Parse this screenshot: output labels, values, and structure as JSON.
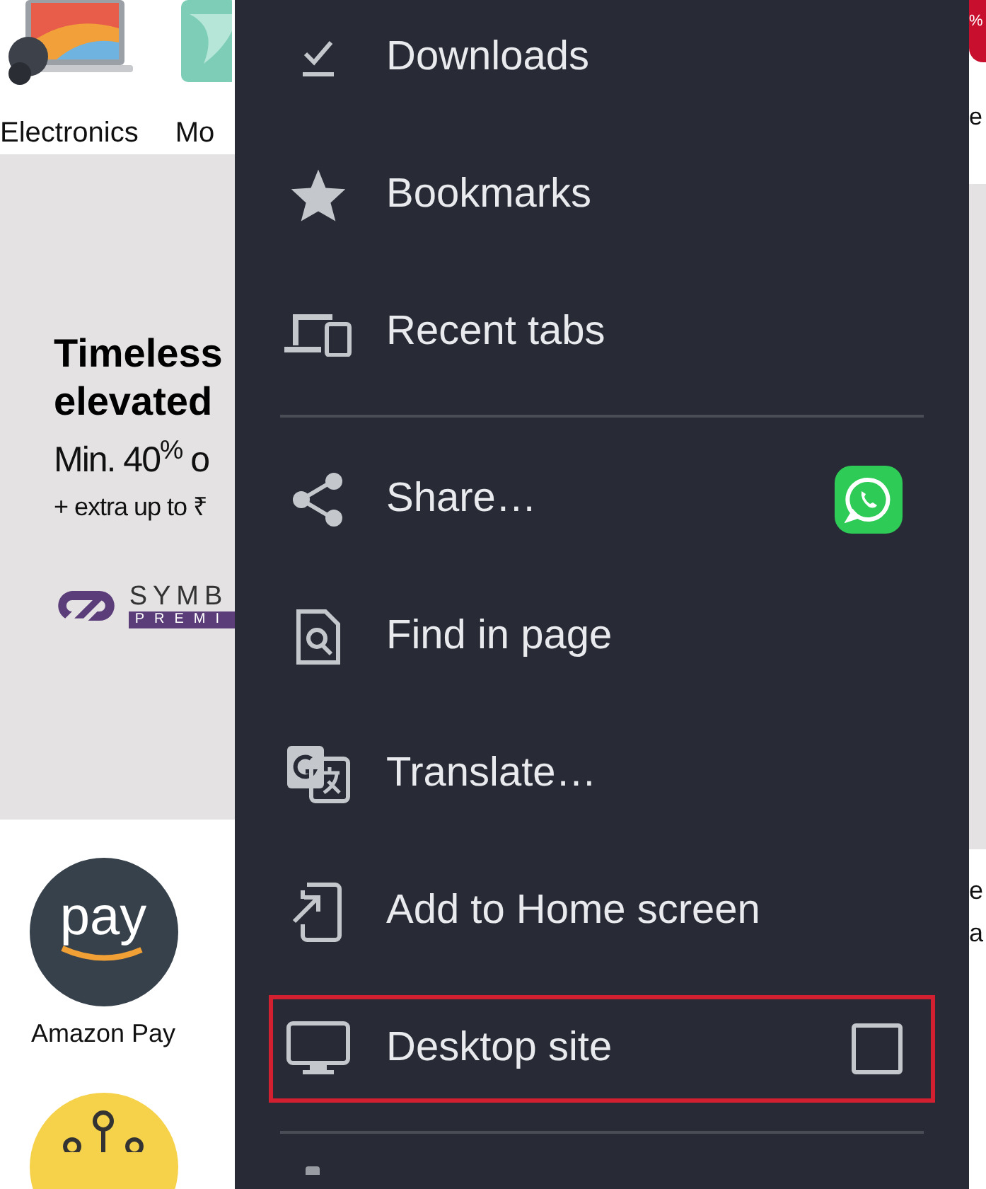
{
  "page": {
    "categories": [
      {
        "label": "Electronics"
      },
      {
        "label": "Mo"
      }
    ],
    "banner": {
      "title_lines": [
        "Timeless",
        "elevated"
      ],
      "offer": "Min. 40$^{%}$ o",
      "extra": "+ extra up to ₹",
      "brand": "SYMB",
      "brand_sub": "PREMI"
    },
    "shortcuts": [
      {
        "kind": "pay",
        "label": "Amazon Pay",
        "icon_text": "pay"
      },
      {
        "kind": "round"
      }
    ],
    "right_edge": {
      "badge": "%",
      "texts": [
        "e",
        "e",
        "a"
      ]
    }
  },
  "menu": {
    "items": [
      {
        "kind": "item",
        "label": "Downloads"
      },
      {
        "kind": "item",
        "label": "Bookmarks"
      },
      {
        "kind": "item",
        "label": "Recent tabs"
      },
      {
        "kind": "divider"
      },
      {
        "kind": "share",
        "label": "Share…"
      },
      {
        "kind": "item",
        "label": "Find in page"
      },
      {
        "kind": "item",
        "label": "Translate…"
      },
      {
        "kind": "item",
        "label": "Add to Home screen"
      },
      {
        "kind": "checkbox",
        "label": "Desktop site",
        "checked": false,
        "highlighted": true
      },
      {
        "kind": "divider"
      },
      {
        "kind": "partial"
      }
    ]
  }
}
